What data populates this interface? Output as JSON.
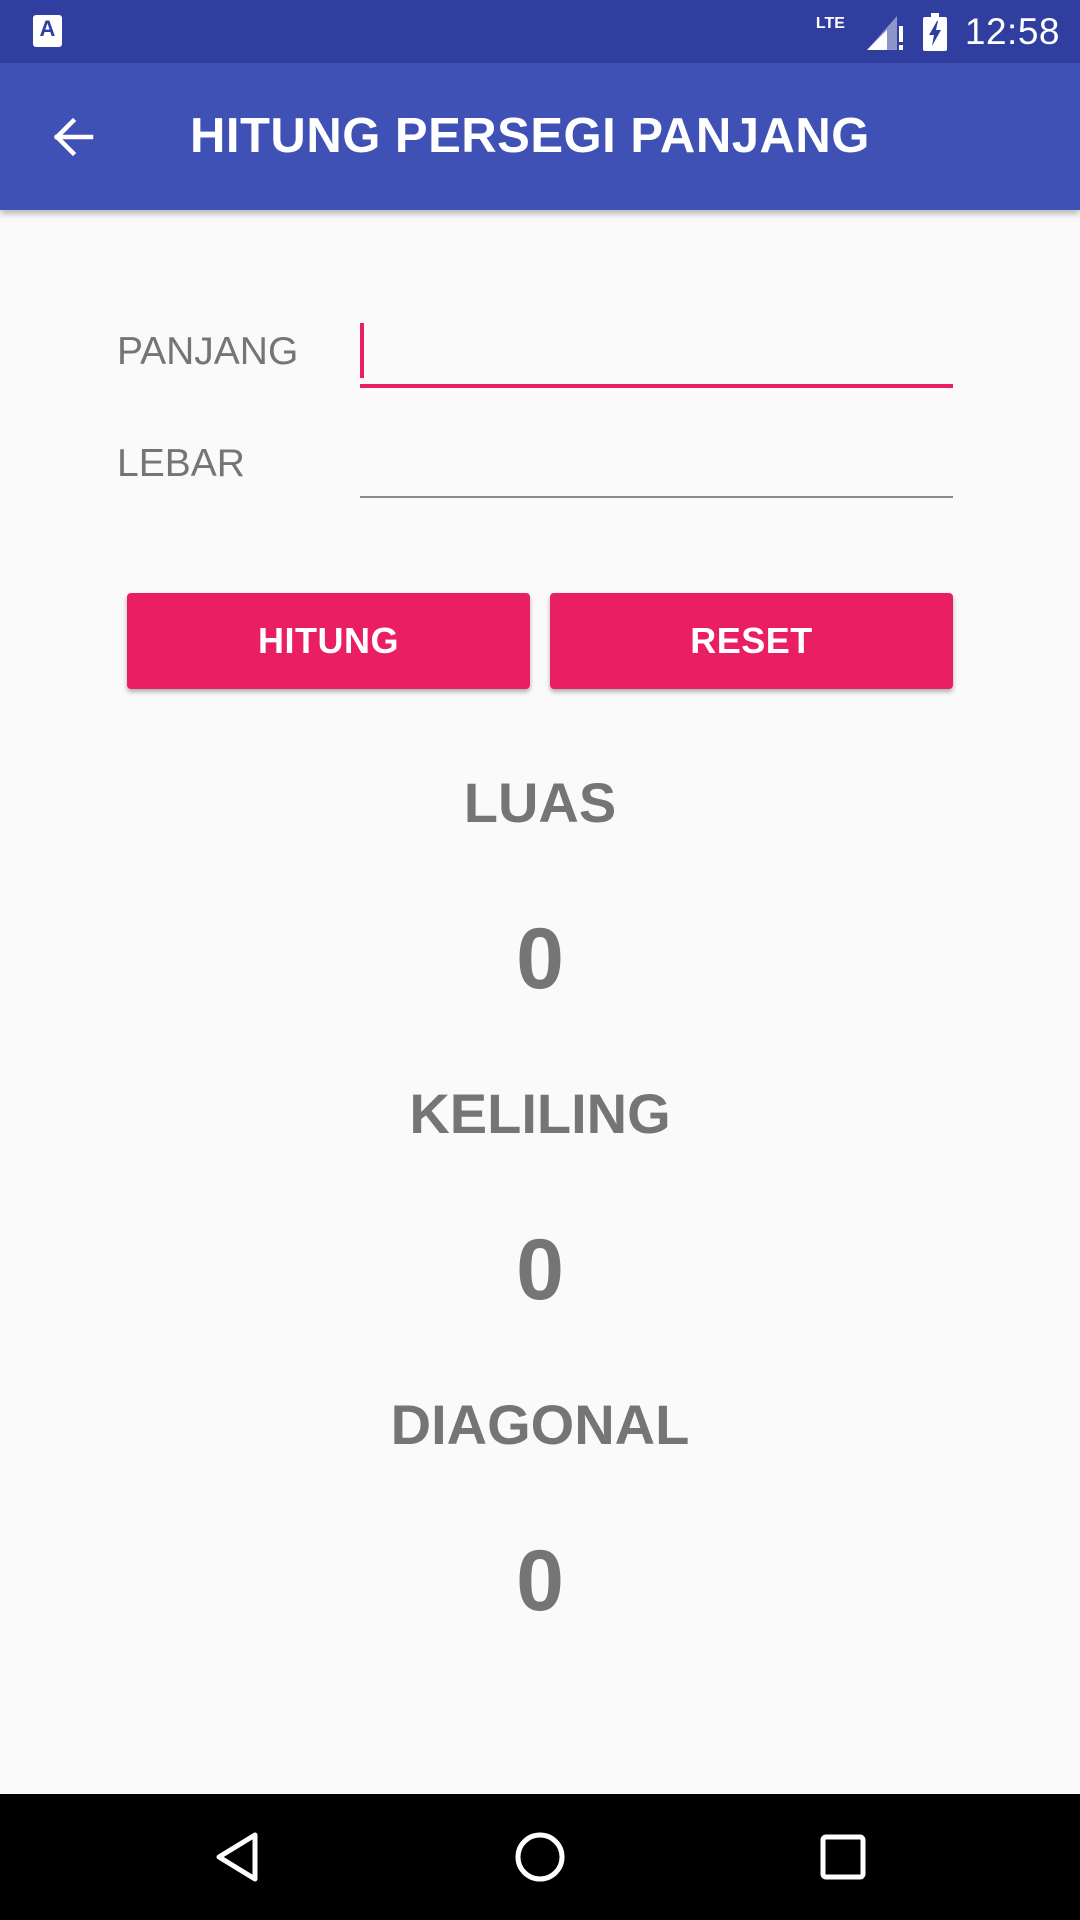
{
  "status_bar": {
    "notification_icon": "text-a-icon",
    "notification_glyph": "A",
    "network_label": "LTE",
    "time": "12:58"
  },
  "app_bar": {
    "title": "HITUNG PERSEGI PANJANG",
    "back_icon": "arrow-back-icon"
  },
  "form": {
    "panjang_label": "PANJANG",
    "panjang_value": "",
    "lebar_label": "LEBAR",
    "lebar_value": ""
  },
  "buttons": {
    "hitung_label": "HITUNG",
    "reset_label": "RESET"
  },
  "results": {
    "luas_label": "LUAS",
    "luas_value": "0",
    "keliling_label": "KELILING",
    "keliling_value": "0",
    "diagonal_label": "DIAGONAL",
    "diagonal_value": "0"
  },
  "colors": {
    "primary_dark": "#303f9f",
    "primary": "#3f51b5",
    "accent": "#e91e63",
    "text_secondary": "#757575"
  }
}
